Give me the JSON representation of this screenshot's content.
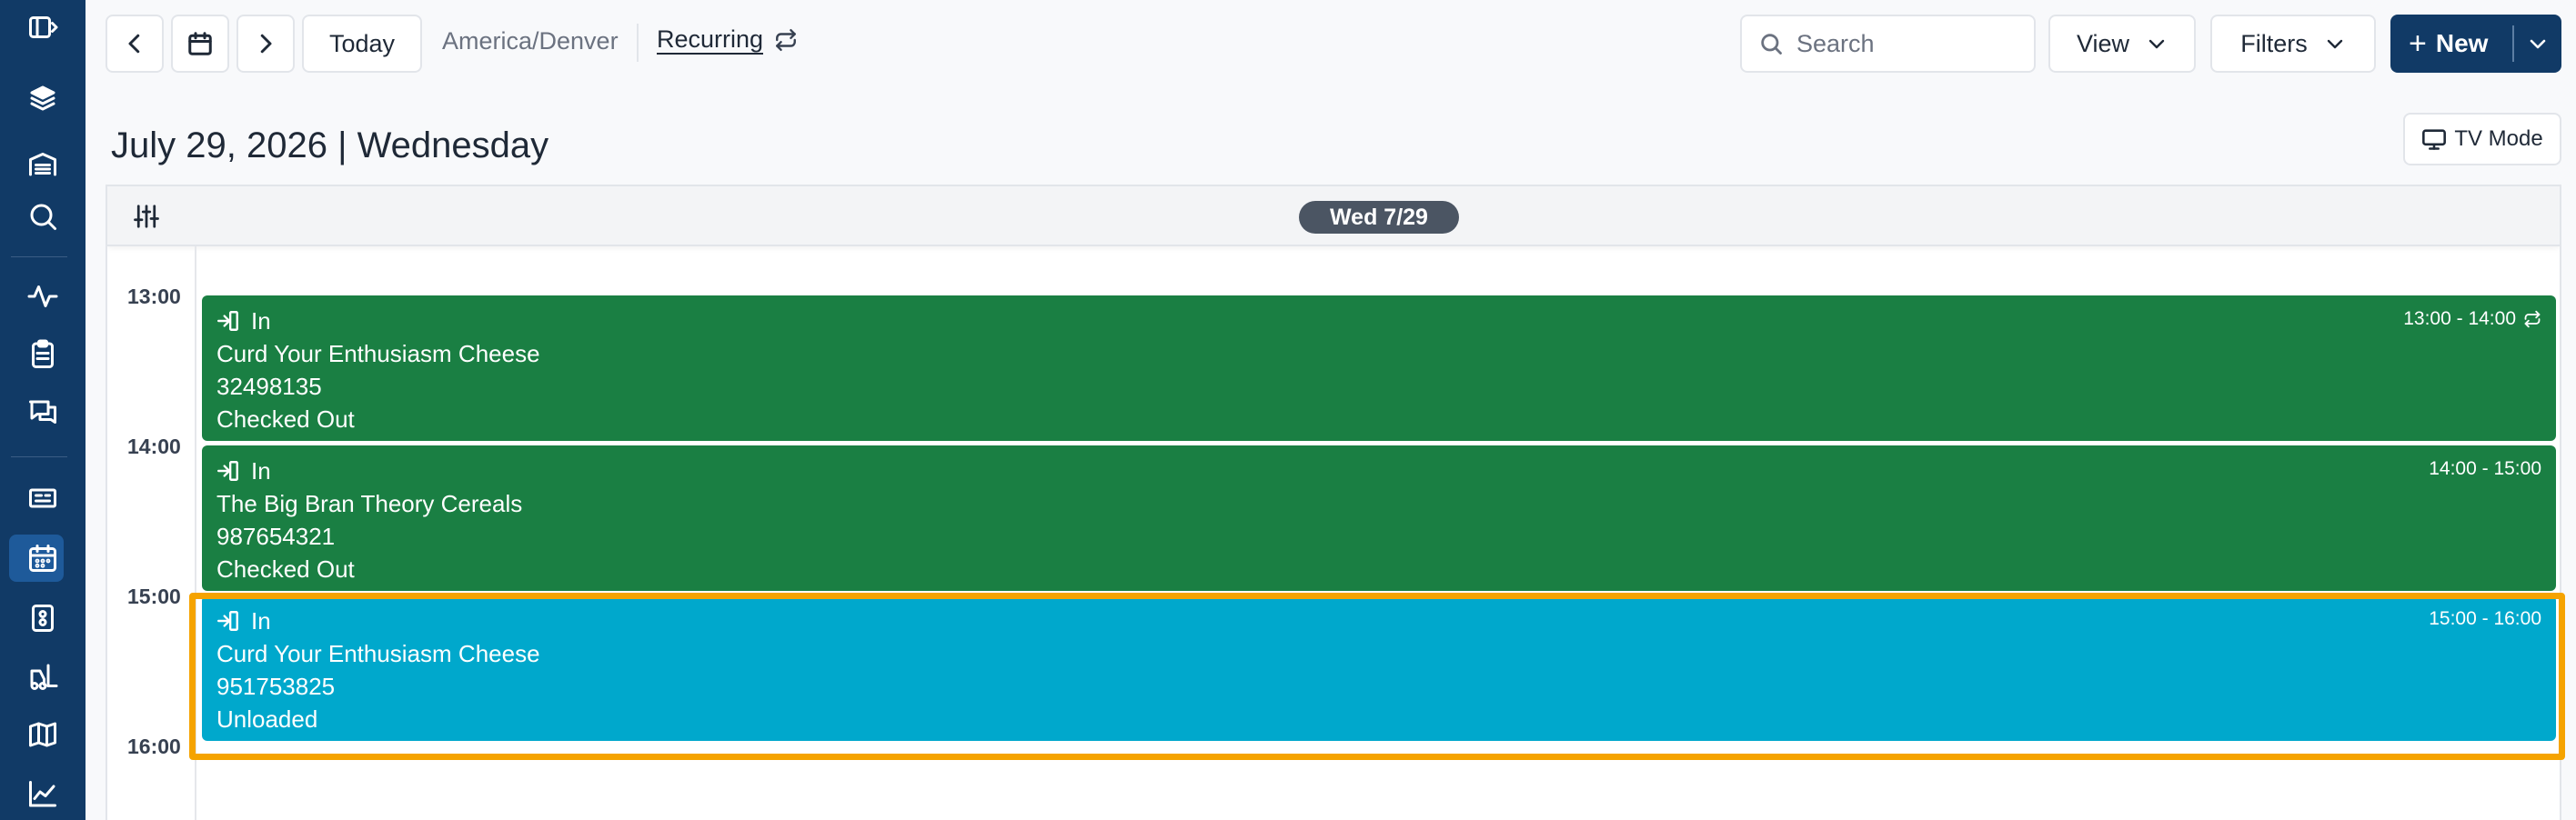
{
  "toolbar": {
    "today_label": "Today",
    "timezone": "America/Denver",
    "recurring_label": "Recurring",
    "search_placeholder": "Search",
    "view_label": "View",
    "filters_label": "Filters",
    "new_label": "New"
  },
  "header": {
    "date_title": "July 29, 2026 | Wednesday",
    "tv_mode_label": "TV Mode"
  },
  "calendar": {
    "day_label": "Wed 7/29",
    "hours": [
      "13:00",
      "14:00",
      "15:00",
      "16:00"
    ],
    "events": [
      {
        "direction": "In",
        "carrier": "Curd Your Enthusiasm Cheese",
        "ref": "32498135",
        "status": "Checked Out",
        "time": "13:00 - 14:00",
        "recurring": true,
        "color": "#1a7f43"
      },
      {
        "direction": "In",
        "carrier": "The Big Bran Theory Cereals",
        "ref": "987654321",
        "status": "Checked Out",
        "time": "14:00 - 15:00",
        "recurring": false,
        "color": "#1a7f43"
      },
      {
        "direction": "In",
        "carrier": "Curd Your Enthusiasm Cheese",
        "ref": "951753825",
        "status": "Unloaded",
        "time": "15:00 - 16:00",
        "recurring": false,
        "color": "#00a8cc"
      }
    ]
  },
  "colors": {
    "sidebar": "#113a66",
    "primary": "#113a66",
    "highlight": "#f5a300"
  },
  "sidebar_icons": [
    "sidebar-toggle-icon",
    "stack-logo-icon",
    "warehouse-icon",
    "search-icon",
    "activity-icon",
    "clipboard-icon",
    "messages-icon",
    "ticket-icon",
    "calendar-icon",
    "dock-icon",
    "forklift-icon",
    "map-icon",
    "chart-icon"
  ]
}
